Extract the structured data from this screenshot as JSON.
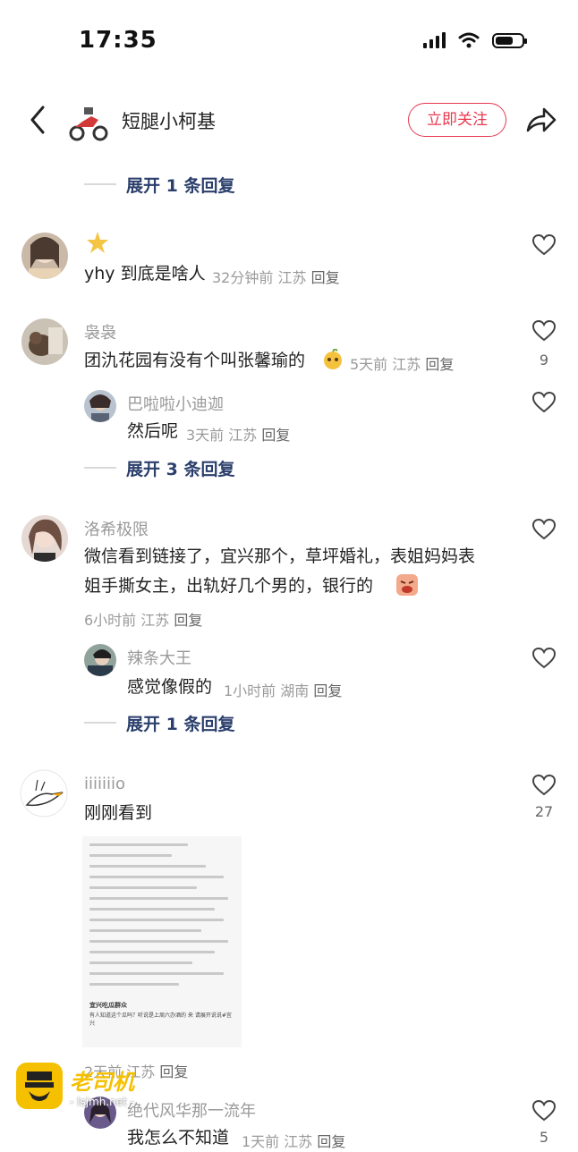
{
  "status": {
    "time": "17:35"
  },
  "header": {
    "name": "短腿小柯基",
    "follow_label": "立即关注"
  },
  "expand_top": "展开 1 条回复",
  "c1": {
    "text": "yhy 到底是啥人",
    "time": "32分钟前",
    "loc": "江苏",
    "reply": "回复"
  },
  "c2": {
    "name": "袅袅",
    "text": "团氿花园有没有个叫张馨瑜的",
    "time": "5天前",
    "loc": "江苏",
    "reply": "回复",
    "likes": "9",
    "sub": {
      "name": "巴啦啦小迪迦",
      "text": "然后呢",
      "time": "3天前",
      "loc": "江苏",
      "reply": "回复"
    },
    "expand": "展开 3 条回复"
  },
  "c3": {
    "name": "洛希极限",
    "line1": "微信看到链接了，宜兴那个，草坪婚礼，表姐妈妈表",
    "line2": "姐手撕女主，出轨好几个男的，银行的",
    "time": "6小时前",
    "loc": "江苏",
    "reply": "回复",
    "sub": {
      "name": "辣条大王",
      "text": "感觉像假的",
      "time": "1小时前",
      "loc": "湖南",
      "reply": "回复"
    },
    "expand": "展开 1 条回复"
  },
  "c4": {
    "name": "iiiiiiio",
    "text": "刚刚看到",
    "likes": "27",
    "time": "2天前",
    "loc": "江苏",
    "reply": "回复",
    "doc": {
      "title": "宜兴吃瓜群众",
      "body": "有人知道这个瓜吗？听说是上周六办酒的 来 请展开说说#宜兴"
    }
  },
  "c5": {
    "name": "绝代风华那一流年",
    "text": "我怎么不知道",
    "time": "1天前",
    "loc": "江苏",
    "reply": "回复",
    "likes": "5"
  },
  "watermark": {
    "title": "老司机",
    "url": "- lsjmh.net -"
  },
  "icons": {
    "back": "chevron-left-icon",
    "share": "share-arrow-icon",
    "heart": "heart-outline-icon"
  }
}
